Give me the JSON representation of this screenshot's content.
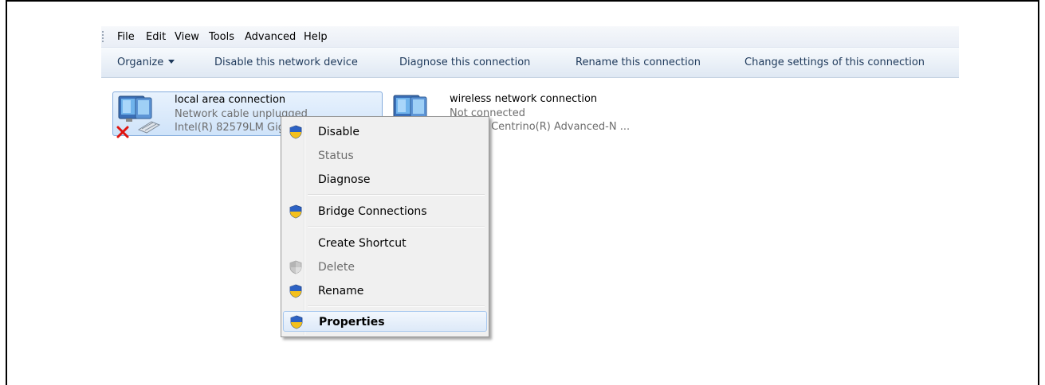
{
  "menubar": {
    "items": [
      "File",
      "Edit",
      "View",
      "Tools",
      "Advanced",
      "Help"
    ]
  },
  "commandbar": {
    "organize": "Organize",
    "disable_device": "Disable this network device",
    "diagnose": "Diagnose this connection",
    "rename": "Rename this connection",
    "change_settings": "Change settings of this connection"
  },
  "connections": [
    {
      "name": "local area connection",
      "status": "Network cable unplugged",
      "adapter": "Intel(R) 82579LM Gigabit Network Connection",
      "state": "disconnected",
      "icon": "network-adapter-icon"
    },
    {
      "name": "wireless network connection",
      "status": "Not connected",
      "adapter": "Intel(R) Centrino(R) Advanced-N ...",
      "icon": "wireless-adapter-icon"
    }
  ],
  "context_menu": {
    "items": [
      {
        "label": "Disable",
        "icon": "uac-shield-icon",
        "enabled": true
      },
      {
        "label": "Status",
        "enabled": false
      },
      {
        "label": "Diagnose",
        "enabled": true
      },
      {
        "label": "Bridge Connections",
        "icon": "uac-shield-icon",
        "enabled": true
      },
      {
        "label": "Create Shortcut",
        "enabled": true
      },
      {
        "label": "Delete",
        "icon": "uac-shield-icon",
        "enabled": false
      },
      {
        "label": "Rename",
        "icon": "uac-shield-icon",
        "enabled": true
      },
      {
        "label": "Properties",
        "icon": "uac-shield-icon",
        "enabled": true,
        "default": true,
        "highlighted": true
      }
    ]
  },
  "colors": {
    "command_text": "#1e395b",
    "selection_border": "#84acdd",
    "menu_background": "#f0f0f0"
  }
}
